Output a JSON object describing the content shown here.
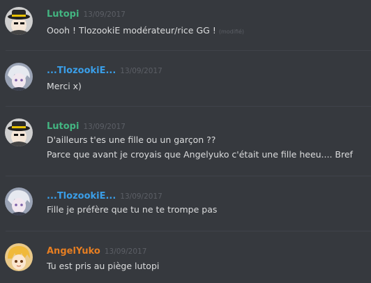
{
  "colors": {
    "background": "#36393e",
    "divider": "#40434a",
    "text": "#dcddde",
    "timestamp": "#5c5f66",
    "user_lutopi": "#43b581",
    "user_tlozookie": "#3a9ee8",
    "user_angelyuko": "#e67e22"
  },
  "messages": [
    {
      "username": "Lutopi",
      "timestamp": "13/09/2017",
      "avatar_icon": "lutopi-avatar-icon",
      "lines": [
        "Oooh ! TlozookiE modérateur/rice GG !"
      ],
      "edited_label": "(modifié)"
    },
    {
      "username": "...TlozookiE...",
      "timestamp": "13/09/2017",
      "avatar_icon": "tlozookie-avatar-icon",
      "lines": [
        "Merci x)"
      ]
    },
    {
      "username": "Lutopi",
      "timestamp": "13/09/2017",
      "avatar_icon": "lutopi-avatar-icon",
      "lines": [
        "D'ailleurs t'es une fille ou un garçon ??",
        "Parce que avant je croyais que Angelyuko c'était une fille heeu.... Bref"
      ]
    },
    {
      "username": "...TlozookiE...",
      "timestamp": "13/09/2017",
      "avatar_icon": "tlozookie-avatar-icon",
      "lines": [
        "Fille je préfère que tu ne te trompe pas"
      ]
    },
    {
      "username": "AngelYuko",
      "timestamp": "13/09/2017",
      "avatar_icon": "angelyuko-avatar-icon",
      "lines": [
        "Tu est pris au piège lutopi"
      ]
    }
  ]
}
